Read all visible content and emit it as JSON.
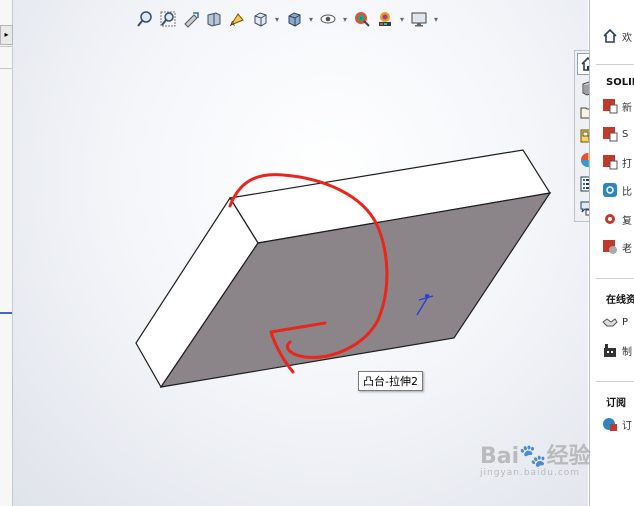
{
  "toolbar": {
    "icons": [
      "zoom-to-fit-icon",
      "zoom-to-area-icon",
      "previous-view-icon",
      "section-view-icon",
      "dynamic-annotation-icon",
      "view-orientation-icon",
      "display-style-icon",
      "hide-show-items-icon",
      "edit-appearance-icon",
      "apply-scene-icon",
      "view-settings-icon"
    ]
  },
  "viewport": {
    "tooltip": "凸台-拉伸2",
    "annotation_color": "#e8261b",
    "face_color": "#8b8589",
    "edge_color": "#1e1e1e"
  },
  "taskpane": {
    "tabs": [
      "home-icon",
      "3d-part-library-icon",
      "file-explorer-icon",
      "view-palette-icon",
      "appearances-icon",
      "custom-properties-icon",
      "forum-icon"
    ]
  },
  "right_panel": {
    "home_label": "欢",
    "section1": "SOLID",
    "items1": [
      "新",
      "S",
      "打",
      "比",
      "复",
      "老"
    ],
    "section2": "在线资",
    "items2": [
      "P",
      "制"
    ],
    "section3": "订阅",
    "items3": [
      "订"
    ]
  },
  "watermark": {
    "brand": "Bai",
    "jingyan": "经验",
    "url": "jingyan.baidu.com"
  }
}
